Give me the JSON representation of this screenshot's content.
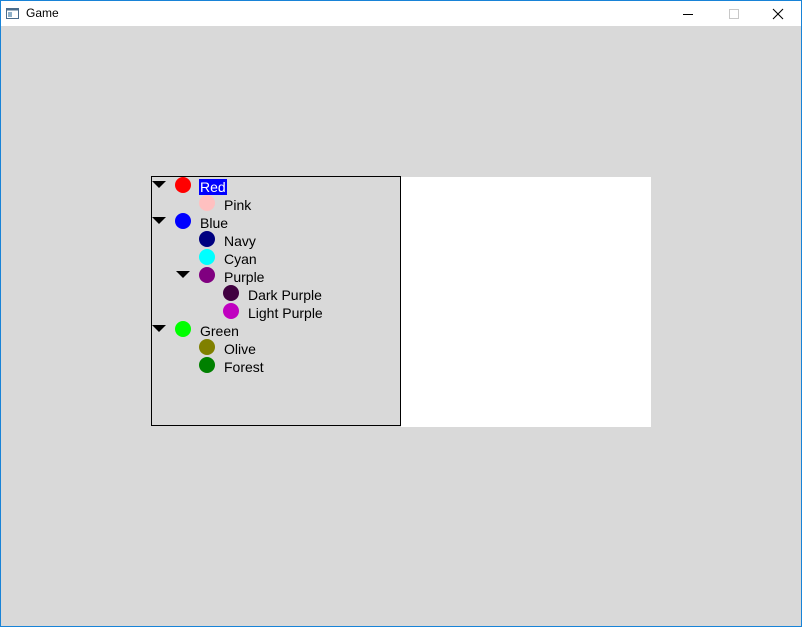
{
  "window": {
    "title": "Game",
    "icon": "window-app-icon"
  },
  "titlebar_buttons": [
    "minimize-icon",
    "maximize-icon",
    "close-icon"
  ],
  "tree": {
    "items": [
      {
        "label": "Red",
        "color": "#ff0000",
        "level": 0,
        "expandable": true,
        "expanded": true,
        "selected": true
      },
      {
        "label": "Pink",
        "color": "#ffc0c0",
        "level": 1,
        "expandable": false
      },
      {
        "label": "Blue",
        "color": "#0000ff",
        "level": 0,
        "expandable": true,
        "expanded": true
      },
      {
        "label": "Navy",
        "color": "#000080",
        "level": 1,
        "expandable": false
      },
      {
        "label": "Cyan",
        "color": "#00ffff",
        "level": 1,
        "expandable": false
      },
      {
        "label": "Purple",
        "color": "#800080",
        "level": 1,
        "expandable": true,
        "expanded": true
      },
      {
        "label": "Dark Purple",
        "color": "#400040",
        "level": 2,
        "expandable": false
      },
      {
        "label": "Light Purple",
        "color": "#c000c0",
        "level": 2,
        "expandable": false
      },
      {
        "label": "Green",
        "color": "#00ff00",
        "level": 0,
        "expandable": true,
        "expanded": true
      },
      {
        "label": "Olive",
        "color": "#808000",
        "level": 1,
        "expandable": false
      },
      {
        "label": "Forest",
        "color": "#008000",
        "level": 1,
        "expandable": false
      }
    ]
  }
}
